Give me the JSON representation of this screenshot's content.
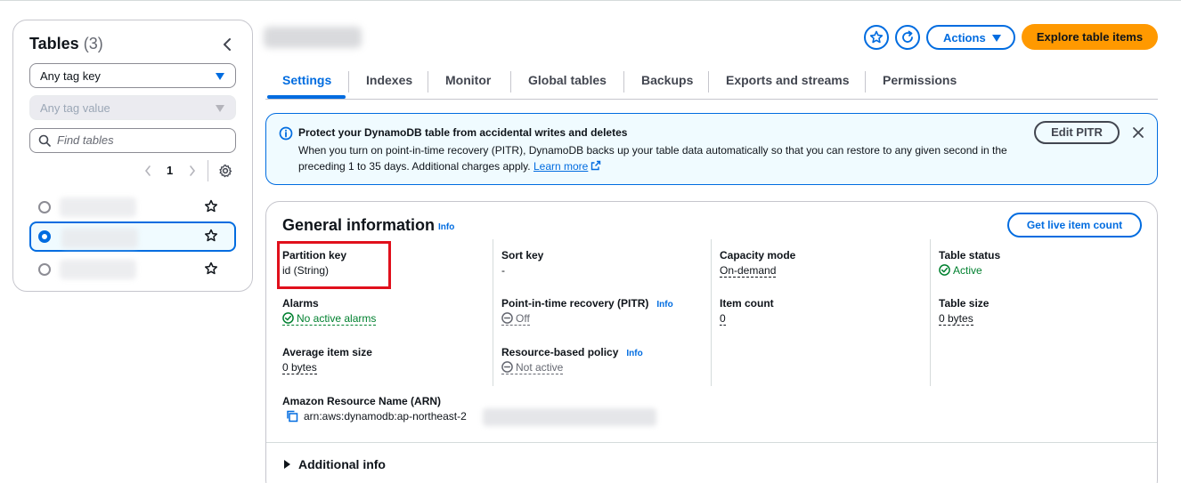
{
  "sidebar": {
    "title": "Tables",
    "count": "(3)",
    "tag_key_placeholder": "Any tag key",
    "tag_value_placeholder": "Any tag value",
    "search_placeholder": "Find tables",
    "page": "1",
    "tables": [
      {
        "selected": false
      },
      {
        "selected": true
      },
      {
        "selected": false
      }
    ]
  },
  "header": {
    "actions_label": "Actions",
    "explore_label": "Explore table items"
  },
  "tabs": [
    "Settings",
    "Indexes",
    "Monitor",
    "Global tables",
    "Backups",
    "Exports and streams",
    "Permissions"
  ],
  "active_tab": "Settings",
  "alert": {
    "title": "Protect your DynamoDB table from accidental writes and deletes",
    "body": "When you turn on point-in-time recovery (PITR), DynamoDB backs up your table data automatically so that you can restore to any given second in the preceding 1 to 35 days. Additional charges apply.",
    "link": "Learn more",
    "button": "Edit PITR"
  },
  "general": {
    "title": "General information",
    "info": "Info",
    "live_count_button": "Get live item count",
    "partition_key_label": "Partition key",
    "partition_key_value": "id (String)",
    "sort_key_label": "Sort key",
    "sort_key_value": "-",
    "capacity_mode_label": "Capacity mode",
    "capacity_mode_value": "On-demand",
    "table_status_label": "Table status",
    "table_status_value": "Active",
    "alarms_label": "Alarms",
    "alarms_value": "No active alarms",
    "pitr_label": "Point-in-time recovery (PITR)",
    "pitr_value": "Off",
    "item_count_label": "Item count",
    "item_count_value": "0",
    "table_size_label": "Table size",
    "table_size_value": "0 bytes",
    "avg_item_size_label": "Average item size",
    "avg_item_size_value": "0 bytes",
    "resource_policy_label": "Resource-based policy",
    "resource_policy_value": "Not active",
    "arn_label": "Amazon Resource Name (ARN)",
    "arn_value": "arn:aws:dynamodb:ap-northeast-2",
    "additional_info": "Additional info"
  },
  "colors": {
    "accent": "#006ce0",
    "primary_button": "#ff9900",
    "success": "#00802f",
    "highlight_box": "#e0101c"
  }
}
